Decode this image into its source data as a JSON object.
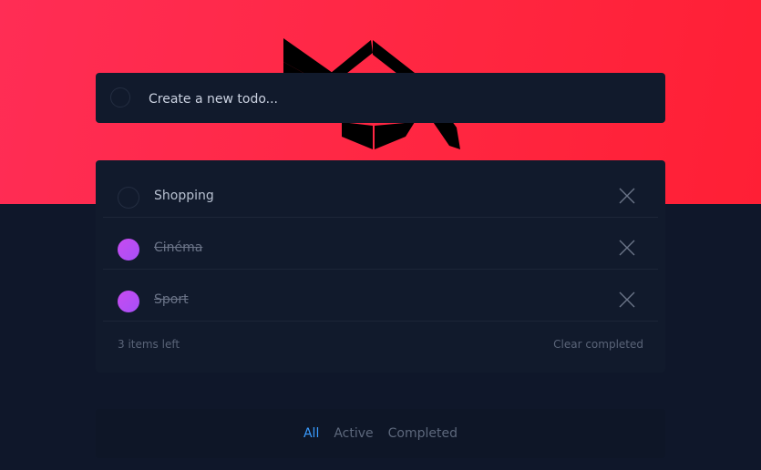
{
  "new_todo": {
    "placeholder": "Create a new todo..."
  },
  "todos": [
    {
      "label": "Shopping",
      "completed": false
    },
    {
      "label": "Cinéma",
      "completed": true
    },
    {
      "label": "Sport",
      "completed": true
    }
  ],
  "footer": {
    "items_left": "3 items left",
    "clear_label": "Clear completed"
  },
  "filters": [
    {
      "label": "All",
      "active": true
    },
    {
      "label": "Active",
      "active": false
    },
    {
      "label": "Completed",
      "active": false
    }
  ],
  "colors": {
    "hero_start": "#ff2d55",
    "hero_end": "#ff1f35",
    "check_gradient_start": "#c84bf0",
    "check_gradient_end": "#a650f7",
    "active_filter": "#3a9cff",
    "background": "#0f172a"
  }
}
